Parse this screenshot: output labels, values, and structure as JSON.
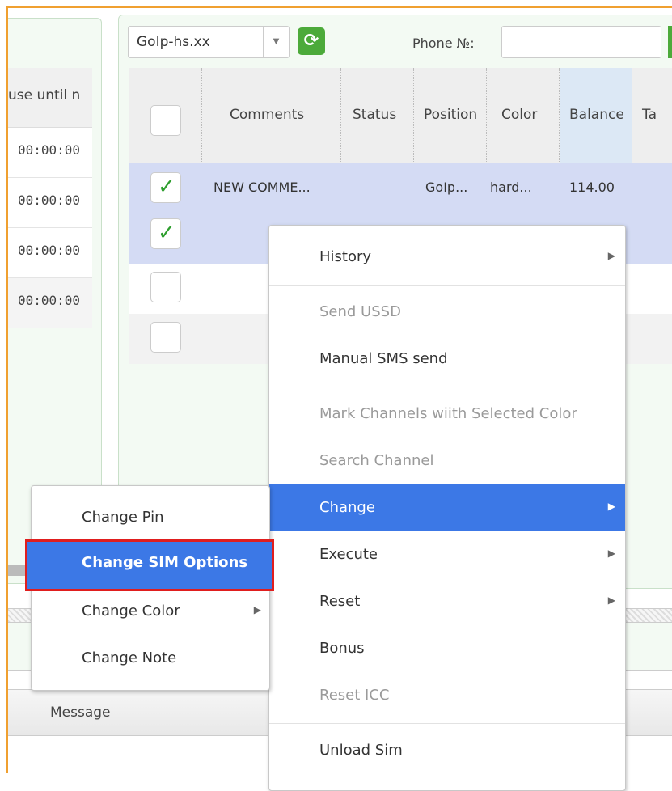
{
  "left_grid": {
    "header_label": "use until n",
    "rows": [
      "00:00:00",
      "00:00:00",
      "00:00:00",
      "00:00:00"
    ]
  },
  "toolbar": {
    "device_select_value": "GoIp-hs.xx",
    "phone_label": "Phone №:",
    "phone_value": ""
  },
  "grid": {
    "columns": [
      "Comments",
      "Status",
      "Position",
      "Color",
      "Balance",
      "Ta"
    ],
    "rows": [
      {
        "checked": true,
        "comment": "NEW COMME...",
        "status": "",
        "position": "GoIp...",
        "color": "hard...",
        "balance": "114.00"
      },
      {
        "checked": true,
        "comment": "",
        "status": "",
        "position": "",
        "color": "",
        "balance": ""
      },
      {
        "checked": false,
        "comment": "",
        "status": "",
        "position": "",
        "color": "",
        "balance": ""
      },
      {
        "checked": false,
        "comment": "",
        "status": "",
        "position": "",
        "color": "",
        "balance": ""
      }
    ]
  },
  "footer": {
    "message_label": "Message"
  },
  "context_menu": {
    "items": [
      {
        "label": "History",
        "disabled": false,
        "submenu": true
      },
      {
        "label": "Send USSD",
        "disabled": true,
        "submenu": false
      },
      {
        "label": "Manual SMS send",
        "disabled": false,
        "submenu": false
      },
      {
        "label": "Mark Channels wiith Selected Color",
        "disabled": true,
        "submenu": false
      },
      {
        "label": "Search Channel",
        "disabled": true,
        "submenu": false
      },
      {
        "label": "Change",
        "disabled": false,
        "submenu": true,
        "active": true
      },
      {
        "label": "Execute",
        "disabled": false,
        "submenu": true
      },
      {
        "label": "Reset",
        "disabled": false,
        "submenu": true
      },
      {
        "label": "Bonus",
        "disabled": false,
        "submenu": false
      },
      {
        "label": "Reset ICC",
        "disabled": true,
        "submenu": false
      },
      {
        "label": "Unload Sim",
        "disabled": false,
        "submenu": false
      }
    ]
  },
  "change_submenu": {
    "items": [
      {
        "label": "Change Pin"
      },
      {
        "label": "Change SIM Options",
        "active": true,
        "highlighted": true
      },
      {
        "label": "Change Color",
        "submenu": true
      },
      {
        "label": "Change Note"
      }
    ]
  },
  "colors": {
    "accent": "#3c78e6",
    "highlight_border": "#e01e1e",
    "refresh_green": "#4caa3a",
    "selected_row": "#d4dbf4"
  }
}
